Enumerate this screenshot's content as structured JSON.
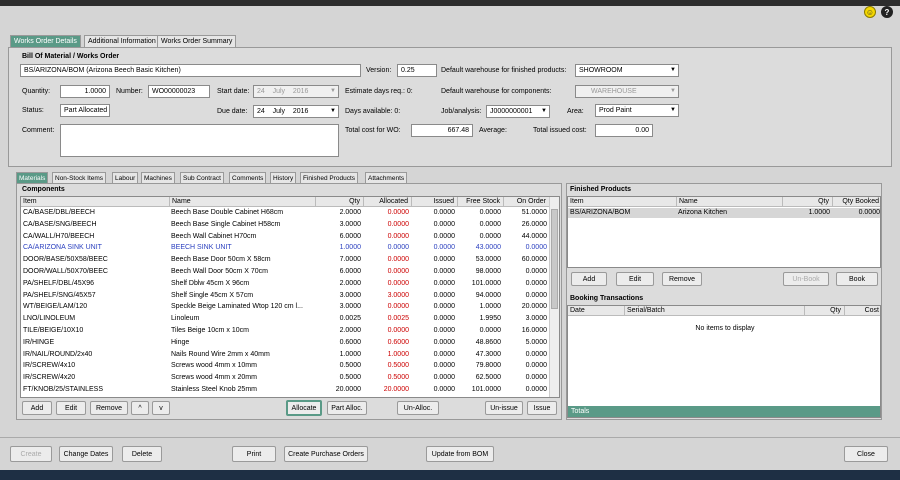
{
  "tabs": [
    "Works Order Details",
    "Additional Information",
    "Works Order Summary"
  ],
  "bom_header": "Bill Of Material / Works Order",
  "bom": {
    "value": "BS/ARIZONA/BOM  (Arizona Beech Basic Kitchen)"
  },
  "version": {
    "label": "Version:",
    "value": "0.25"
  },
  "default_wh_finished": {
    "label": "Default warehouse for finished products:",
    "value": "SHOWROOM"
  },
  "quantity": {
    "label": "Quantity:",
    "value": "1.0000"
  },
  "number": {
    "label": "Number:",
    "value": "WO00000023"
  },
  "start_date": {
    "label": "Start date:",
    "day": "24",
    "month": "July",
    "year": "2016"
  },
  "estimate_days": {
    "label": "Estimate days req.: 0:"
  },
  "default_wh_components": {
    "label": "Default warehouse for components:",
    "value": "WAREHOUSE"
  },
  "status": {
    "label": "Status:",
    "value": "Part Allocated"
  },
  "due_date": {
    "label": "Due date:",
    "day": "24",
    "month": "July",
    "year": "2016"
  },
  "days_available": {
    "label": "Days available: 0:"
  },
  "job_analysis": {
    "label": "Job/analysis:",
    "value": "J0000000001"
  },
  "area": {
    "label": "Area:",
    "value": "Prod Paint"
  },
  "comment": {
    "label": "Comment:",
    "value": ""
  },
  "total_cost": {
    "label": "Total cost for WO:",
    "value": "667.48"
  },
  "average": {
    "label": "Average:"
  },
  "total_issued": {
    "label": "Total issued cost:",
    "value": "0.00"
  },
  "subtabs": [
    "Materials",
    "Non-Stock Items",
    "Labour",
    "Machines",
    "Sub Contract",
    "Comments",
    "History",
    "Finished Products",
    "Attachments"
  ],
  "components": {
    "title": "Components",
    "columns": [
      "Item",
      "Name",
      "Qty",
      "Allocated",
      "Issued",
      "Free Stock",
      "On Order"
    ],
    "rows": [
      [
        "CA/BASE/DBL/BEECH",
        "Beech Base Double Cabinet H68cm",
        "2.0000",
        "0.0000",
        "0.0000",
        "0.0000",
        "51.0000"
      ],
      [
        "CA/BASE/SNG/BEECH",
        "Beech Base Single Cabinet H58cm",
        "3.0000",
        "0.0000",
        "0.0000",
        "0.0000",
        "26.0000"
      ],
      [
        "CA/WALL/H70/BEECH",
        "Beech Wall Cabinet H70cm",
        "6.0000",
        "0.0000",
        "0.0000",
        "0.0000",
        "44.0000"
      ],
      [
        "CA/ARIZONA SINK UNIT",
        "BEECH SINK UNIT",
        "1.0000",
        "0.0000",
        "0.0000",
        "43.0000",
        "0.0000"
      ],
      [
        "DOOR/BASE/50X58/BEEC",
        "Beech Base Door 50cm X 58cm",
        "7.0000",
        "0.0000",
        "0.0000",
        "53.0000",
        "60.0000"
      ],
      [
        "DOOR/WALL/50X70/BEEC",
        "Beech Wall Door 50cm X 70cm",
        "6.0000",
        "0.0000",
        "0.0000",
        "98.0000",
        "0.0000"
      ],
      [
        "PA/SHELF/DBL/45X96",
        "Shelf Dblw 45cm X 96cm",
        "2.0000",
        "0.0000",
        "0.0000",
        "101.0000",
        "0.0000"
      ],
      [
        "PA/SHELF/SNG/45X57",
        "Shelf  Single 45cm X 57cm",
        "3.0000",
        "3.0000",
        "0.0000",
        "94.0000",
        "0.0000"
      ],
      [
        "WT/BEIGE/LAM/120",
        "Speckle Beige Laminated Wtop 120 cm l...",
        "3.0000",
        "0.0000",
        "0.0000",
        "1.0000",
        "20.0000"
      ],
      [
        "LNO/LINOLEUM",
        "Linoleum",
        "0.0025",
        "0.0025",
        "0.0000",
        "1.9950",
        "3.0000"
      ],
      [
        "TILE/BEIGE/10X10",
        "Tiles Beige 10cm x 10cm",
        "2.0000",
        "0.0000",
        "0.0000",
        "0.0000",
        "16.0000"
      ],
      [
        "IR/HINGE",
        "Hinge",
        "0.6000",
        "0.6000",
        "0.0000",
        "48.8600",
        "5.0000"
      ],
      [
        "IR/NAIL/ROUND/2x40",
        "Nails Round Wire 2mm x 40mm",
        "1.0000",
        "1.0000",
        "0.0000",
        "47.3000",
        "0.0000"
      ],
      [
        "IR/SCREW/4x10",
        "Screws wood 4mm x 10mm",
        "0.5000",
        "0.5000",
        "0.0000",
        "79.8000",
        "0.0000"
      ],
      [
        "IR/SCREW/4x20",
        "Screws wood 4mm x 20mm",
        "0.5000",
        "0.5000",
        "0.0000",
        "62.5000",
        "0.0000"
      ],
      [
        "FT/KNOB/25/STAINLESS",
        "Stainless Steel Knob 25mm",
        "20.0000",
        "20.0000",
        "0.0000",
        "101.0000",
        "0.0000"
      ]
    ]
  },
  "materials_buttons": [
    "Add",
    "Edit",
    "Remove",
    "^",
    "v",
    "Allocate",
    "Part Alloc.",
    "Un-Alloc.",
    "Un-issue",
    "Issue"
  ],
  "finished_products": {
    "title": "Finished Products",
    "columns": [
      "Item",
      "Name",
      "Qty",
      "Qty Booked"
    ],
    "rows": [
      [
        "BS/ARIZONA/BOM",
        "Arizona Kitchen",
        "1.0000",
        "0.0000"
      ]
    ],
    "buttons": [
      "Add",
      "Edit",
      "Remove",
      "Un-Book",
      "Book"
    ]
  },
  "booking": {
    "title": "Booking Transactions",
    "columns": [
      "Date",
      "Serial/Batch",
      "Qty",
      "Cost"
    ],
    "empty": "No items to display",
    "footer": "Totals"
  },
  "bottom_buttons": [
    "Create",
    "Change Dates",
    "Delete",
    "Print",
    "Create Purchase Orders",
    "Update from BOM",
    "Close"
  ],
  "colors": {
    "accent": "#5a9a87",
    "red_value": "#cc0000",
    "blue_row": "#2a3fbf"
  }
}
